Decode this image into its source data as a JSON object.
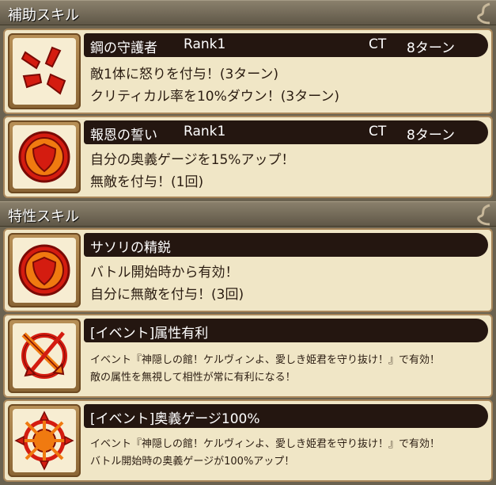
{
  "sections": [
    {
      "title": "補助スキル"
    },
    {
      "title": "特性スキル"
    }
  ],
  "support_skills": [
    {
      "icon": "anger-icon",
      "name": "鋼の守護者",
      "rank": "Rank1",
      "ct_label": "CT",
      "ct_value": "8ターン",
      "lines": [
        "敵1体に怒りを付与！(3ターン)",
        "クリティカル率を10%ダウン！(3ターン)"
      ]
    },
    {
      "icon": "shield-icon",
      "name": "報恩の誓い",
      "rank": "Rank1",
      "ct_label": "CT",
      "ct_value": "8ターン",
      "lines": [
        "自分の奥義ゲージを15%アップ！",
        "無敵を付与！(1回)"
      ]
    }
  ],
  "trait_skills": [
    {
      "icon": "shield-icon",
      "name": "サソリの精鋭",
      "lines": [
        "バトル開始時から有効！",
        "自分に無敵を付与！(3回)"
      ]
    },
    {
      "icon": "attribute-advantage-icon",
      "name": "[イベント]属性有利",
      "lines": [
        "イベント『神隠しの館！ケルヴィンよ、愛しき姫君を守り抜け！』で有効！",
        "敵の属性を無視して相性が常に有利になる！"
      ]
    },
    {
      "icon": "burst-gauge-icon",
      "name": "[イベント]奥義ゲージ100%",
      "lines": [
        "イベント『神隠しの館！ケルヴィンよ、愛しき姫君を守り抜け！』で有効！",
        "バトル開始時の奥義ゲージが100%アップ！"
      ]
    }
  ],
  "colors": {
    "header": "#6f6754",
    "card": "#f0e6c6",
    "title_bar": "#241610",
    "icon_red": "#d41c10",
    "icon_orange": "#f07a10"
  }
}
